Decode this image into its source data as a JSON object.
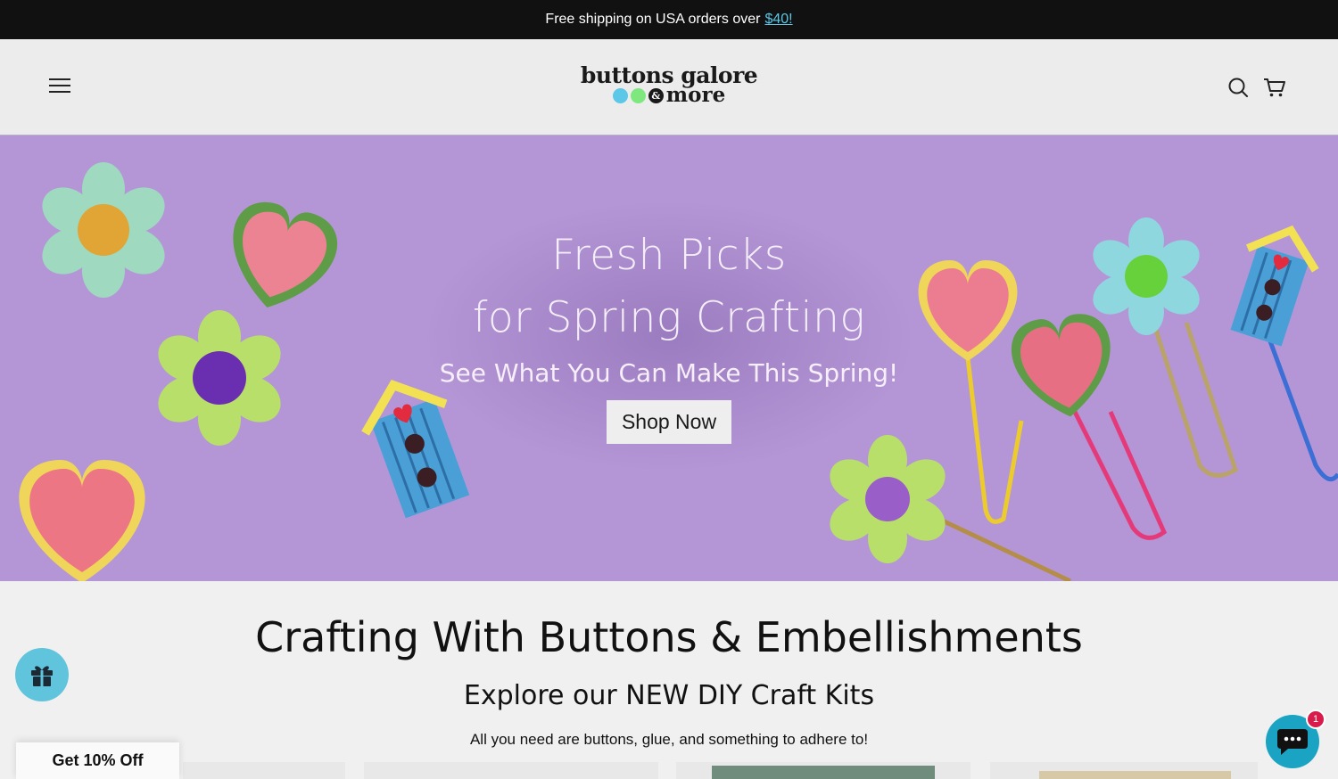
{
  "announcement": {
    "text": "Free shipping on USA orders over",
    "link": "$40!"
  },
  "header": {
    "logo_line1": "buttons galore",
    "logo_amp": "&",
    "logo_line2": "more",
    "logo_dot_colors": [
      "#5cc7e6",
      "#7ee87e"
    ],
    "menu_icon": "hamburger-icon",
    "search_icon": "search-icon",
    "cart_icon": "cart-icon"
  },
  "hero": {
    "title_line1": "Fresh Picks",
    "title_line2": "for Spring Crafting",
    "subtitle": "See What You Can Make This Spring!",
    "cta": "Shop Now",
    "background": "#b496d6"
  },
  "section": {
    "title": "Crafting With Buttons & Embellishments",
    "subtitle": "Explore our NEW DIY Craft Kits",
    "description": "All you need are buttons, glue, and something to adhere to!"
  },
  "widgets": {
    "gift_icon": "gift-icon",
    "discount_label": "Get 10% Off",
    "chat_icon": "chat-icon",
    "chat_badge": "1",
    "accent": "#5fc4dc"
  }
}
